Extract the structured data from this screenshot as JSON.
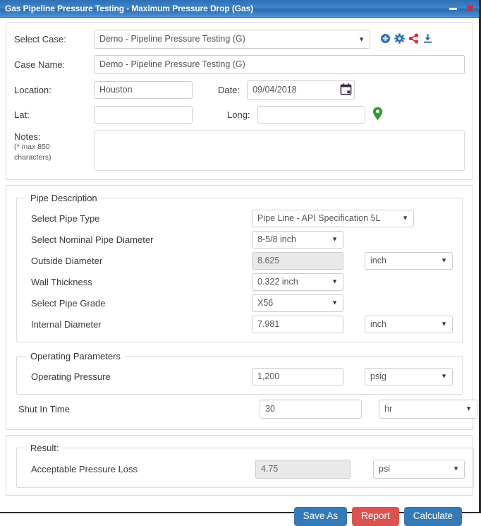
{
  "window": {
    "title": "Gas Pipeline Pressure Testing - Maximum Pressure Drop (Gas)",
    "minimize_icon": "minimize-icon",
    "close_icon": "close-icon",
    "titlebar_color": "#3d85cc"
  },
  "case_section": {
    "select_case_label": "Select Case:",
    "select_case_value": "Demo - Pipeline Pressure Testing (G)",
    "case_name_label": "Case Name:",
    "case_name_value": "Demo -  Pipeline Pressure Testing (G)",
    "location_label": "Location:",
    "location_value": "Houston",
    "date_label": "Date:",
    "date_value": "09/04/2018",
    "lat_label": "Lat:",
    "lat_value": "",
    "lat_placeholder": "",
    "long_label": "Long:",
    "long_value": "",
    "long_placeholder": "",
    "notes_label": "Notes:",
    "notes_hint_line1": "(* max 850",
    "notes_hint_line2": "characters)",
    "notes_value": "",
    "icons": [
      {
        "name": "add-circle-icon",
        "color": "#2a6ebb"
      },
      {
        "name": "gear-icon",
        "color": "#2a6ebb"
      },
      {
        "name": "share-icon",
        "color": "#e8252a"
      },
      {
        "name": "download-icon",
        "color": "#3b6ea5"
      }
    ],
    "calendar_icon": "calendar-icon",
    "map-pin_icon": "map-pin-icon",
    "map_pin_color": "#2e9e2e"
  },
  "pipe_description": {
    "legend": "Pipe Description",
    "rows": [
      {
        "label": "Select Pipe Type",
        "value": "Pipe Line - API Specification 5L",
        "kind": "select",
        "unit": ""
      },
      {
        "label": "Select Nominal Pipe Diameter",
        "value": "8-5/8 inch",
        "kind": "select",
        "unit": ""
      },
      {
        "label": "Outside Diameter",
        "value": "8.625",
        "kind": "readonly",
        "unit": "inch"
      },
      {
        "label": "Wall Thickness",
        "value": "0.322 inch",
        "kind": "select",
        "unit": ""
      },
      {
        "label": "Select Pipe Grade",
        "value": "X56",
        "kind": "select",
        "unit": ""
      },
      {
        "label": "Internal Diameter",
        "value": "7.981",
        "kind": "input",
        "unit": "inch"
      }
    ]
  },
  "operating_parameters": {
    "legend": "Operating Parameters",
    "pressure_label": "Operating Pressure",
    "pressure_value": "1,200",
    "pressure_unit": "psig"
  },
  "shut_in": {
    "label": "Shut In Time",
    "value": "30",
    "unit": "hr"
  },
  "result": {
    "legend": "Result:",
    "label": "Acceptable Pressure Loss",
    "value": "4.75",
    "unit": "psi"
  },
  "buttons": {
    "save_as": "Save As",
    "report": "Report",
    "calculate": "Calculate",
    "blue": "#337ab7",
    "red": "#d9534f"
  }
}
